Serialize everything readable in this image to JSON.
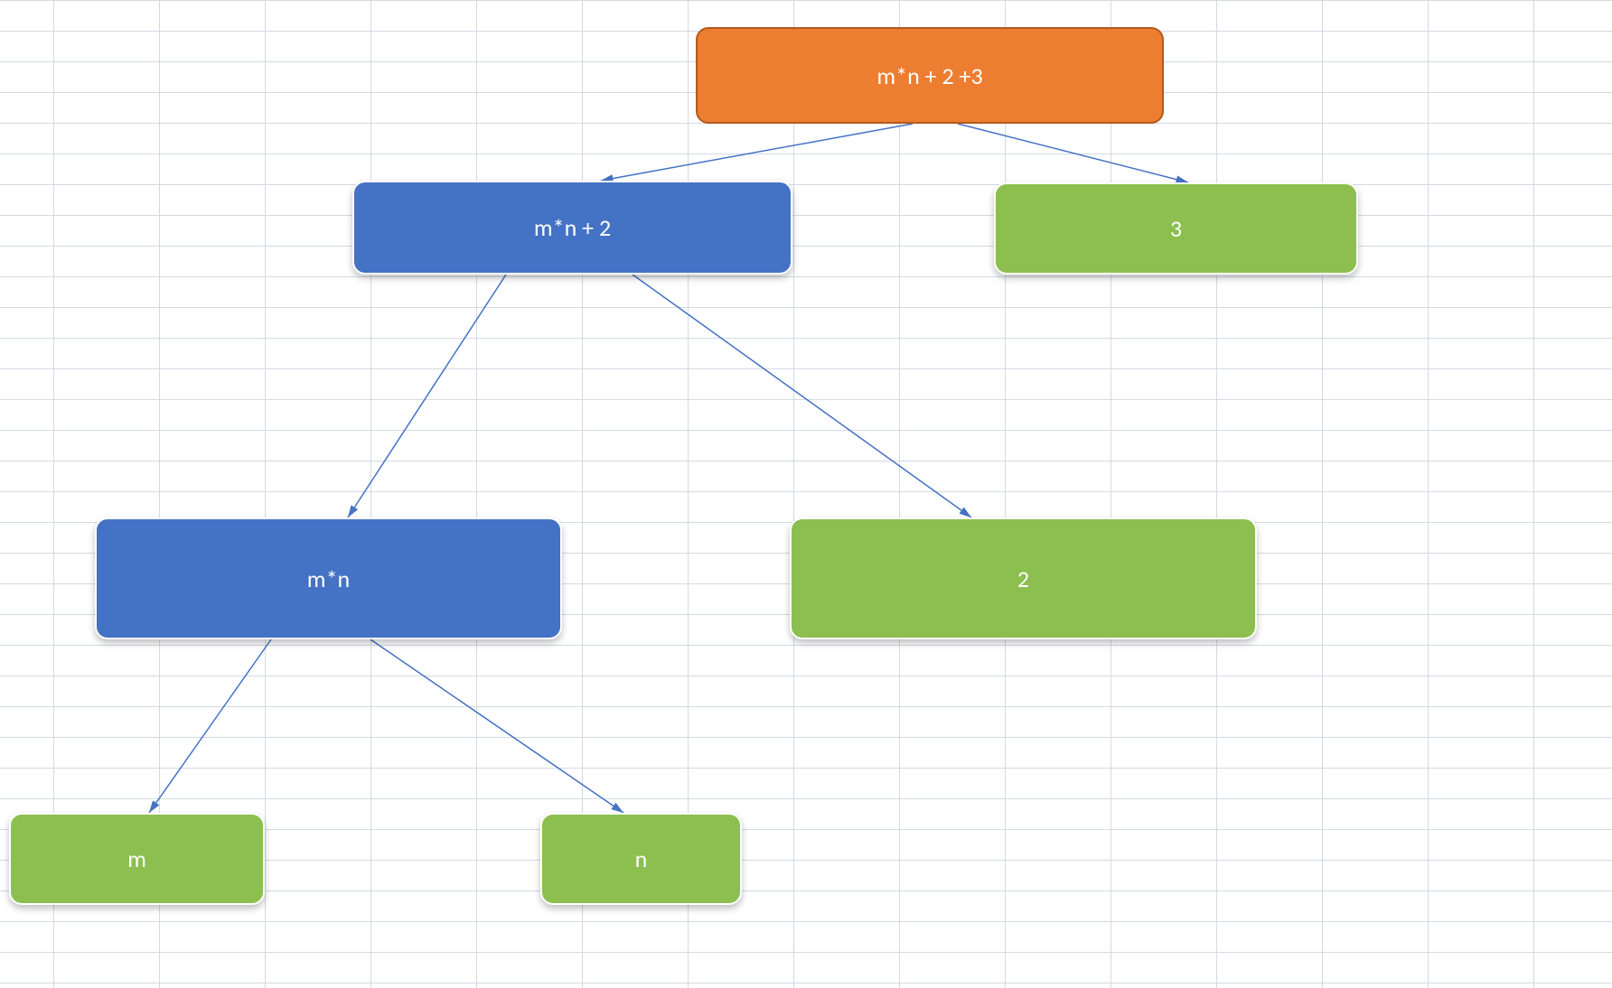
{
  "diagram": {
    "nodes": {
      "root": {
        "label": "m*n + 2 +3"
      },
      "mn2": {
        "label": "m*n + 2"
      },
      "three": {
        "label": "3"
      },
      "mn": {
        "label": "m*n"
      },
      "two": {
        "label": "2"
      },
      "m": {
        "label": "m"
      },
      "n": {
        "label": "n"
      }
    },
    "edges": [
      {
        "from": "root",
        "to": "mn2"
      },
      {
        "from": "root",
        "to": "three"
      },
      {
        "from": "mn2",
        "to": "mn"
      },
      {
        "from": "mn2",
        "to": "two"
      },
      {
        "from": "mn",
        "to": "m"
      },
      {
        "from": "mn",
        "to": "n"
      }
    ],
    "colors": {
      "orange": "#ed7d31",
      "blue": "#4472c4",
      "green": "#8cbf4f",
      "arrow": "#4472c4",
      "grid": "#d4d9e2"
    }
  }
}
